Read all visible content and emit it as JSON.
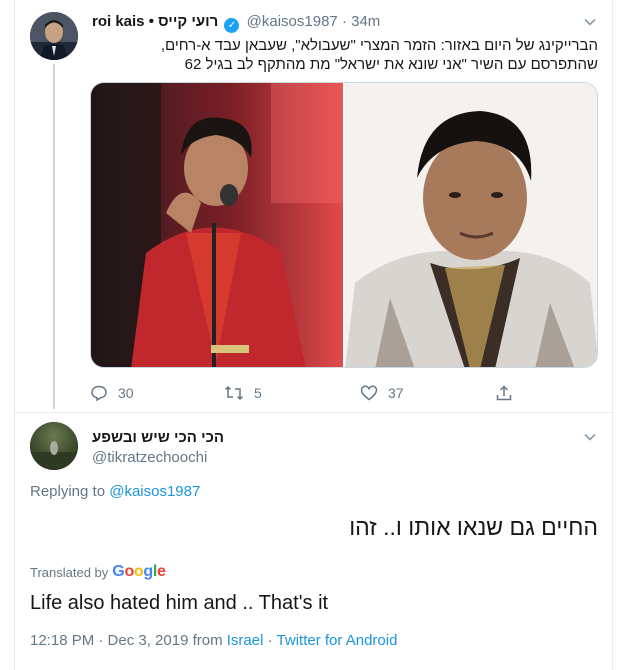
{
  "tweet1": {
    "display_name": "roi kais • רועי קייס",
    "handle": "@kaisos1987",
    "separator": "·",
    "time": "34m",
    "text_line1": "הברייקינג של היום באזור: הזמר המצרי \"שעבולא\", שעבאן עבד א-רחים,",
    "text_line2": "שהתפרסם עם השיר \"אני שונא את ישראל\" מת מהתקף לב בגיל 62",
    "actions": {
      "reply_count": "30",
      "retweet_count": "5",
      "like_count": "37"
    },
    "verified_color": "#1da1f2"
  },
  "tweet2": {
    "display_name": "הכי הכי שיש ובשפע",
    "handle": "@tikratzechoochi",
    "replying_prefix": "Replying to",
    "replying_to": "@kaisos1987",
    "text": "החיים גם שנאו אותו ו.. זהו",
    "translated_by": "Translated by",
    "translator": "Google",
    "translation": "Life also hated him and .. That's it",
    "timestamp": "12:18 PM · Dec 3, 2019 from",
    "location": "Israel",
    "meta_separator": "·",
    "source": "Twitter for Android"
  },
  "colors": {
    "link": "#1b95e0",
    "muted": "#657786",
    "text": "#14171a"
  },
  "icons": [
    "chevron-down-icon",
    "verified-icon",
    "reply-icon",
    "retweet-icon",
    "like-icon",
    "share-icon"
  ]
}
